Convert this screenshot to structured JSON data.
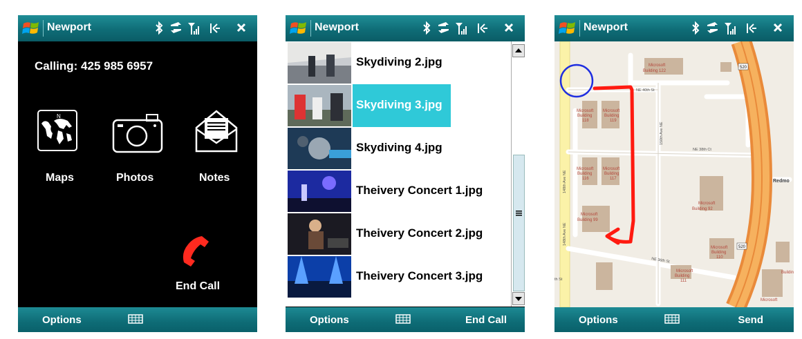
{
  "app_title": "Newport",
  "softbar": {
    "options": "Options",
    "end_call": "End Call",
    "send": "Send"
  },
  "call_screen": {
    "calling_text": "Calling: 425 985 6957",
    "apps": [
      {
        "label": "Maps",
        "icon": "world-map-icon"
      },
      {
        "label": "Photos",
        "icon": "camera-icon"
      },
      {
        "label": "Notes",
        "icon": "envelope-icon"
      }
    ],
    "end_call_label": "End Call"
  },
  "photo_list": {
    "items": [
      {
        "label": "Skydiving 2.jpg",
        "selected": false,
        "thumb": "#6d7b88"
      },
      {
        "label": "Skydiving 3.jpg",
        "selected": true,
        "thumb": "#8a9aa3"
      },
      {
        "label": "Skydiving 4.jpg",
        "selected": false,
        "thumb": "#1f3a52"
      },
      {
        "label": "Theivery Concert 1.jpg",
        "selected": false,
        "thumb": "#2a3aa8"
      },
      {
        "label": "Theivery Concert 2.jpg",
        "selected": false,
        "thumb": "#3a2a20"
      },
      {
        "label": "Theivery Concert 3.jpg",
        "selected": false,
        "thumb": "#1a4fb0"
      }
    ]
  },
  "map": {
    "buildings": [
      "Microsoft Building 122",
      "Microsoft Building 118",
      "Microsoft Building 119",
      "Microsoft Building 116",
      "Microsoft Building 117",
      "Microsoft Building 99",
      "Microsoft Building 92",
      "Microsoft Building 110",
      "Microsoft Building 111",
      "Microsoft Building 43"
    ],
    "streets": [
      "NE 40th St",
      "NE 38th Ct",
      "NE 36th St",
      "148th Ave NE",
      "150th Ave NE",
      "th St"
    ],
    "highway": "520",
    "place_labels": [
      "Redmo",
      "Buildin"
    ]
  },
  "colors": {
    "accent": "#0f6d77",
    "selected": "#2fc9d8",
    "route": "#ff1a10",
    "highway": "#e98a3a"
  }
}
